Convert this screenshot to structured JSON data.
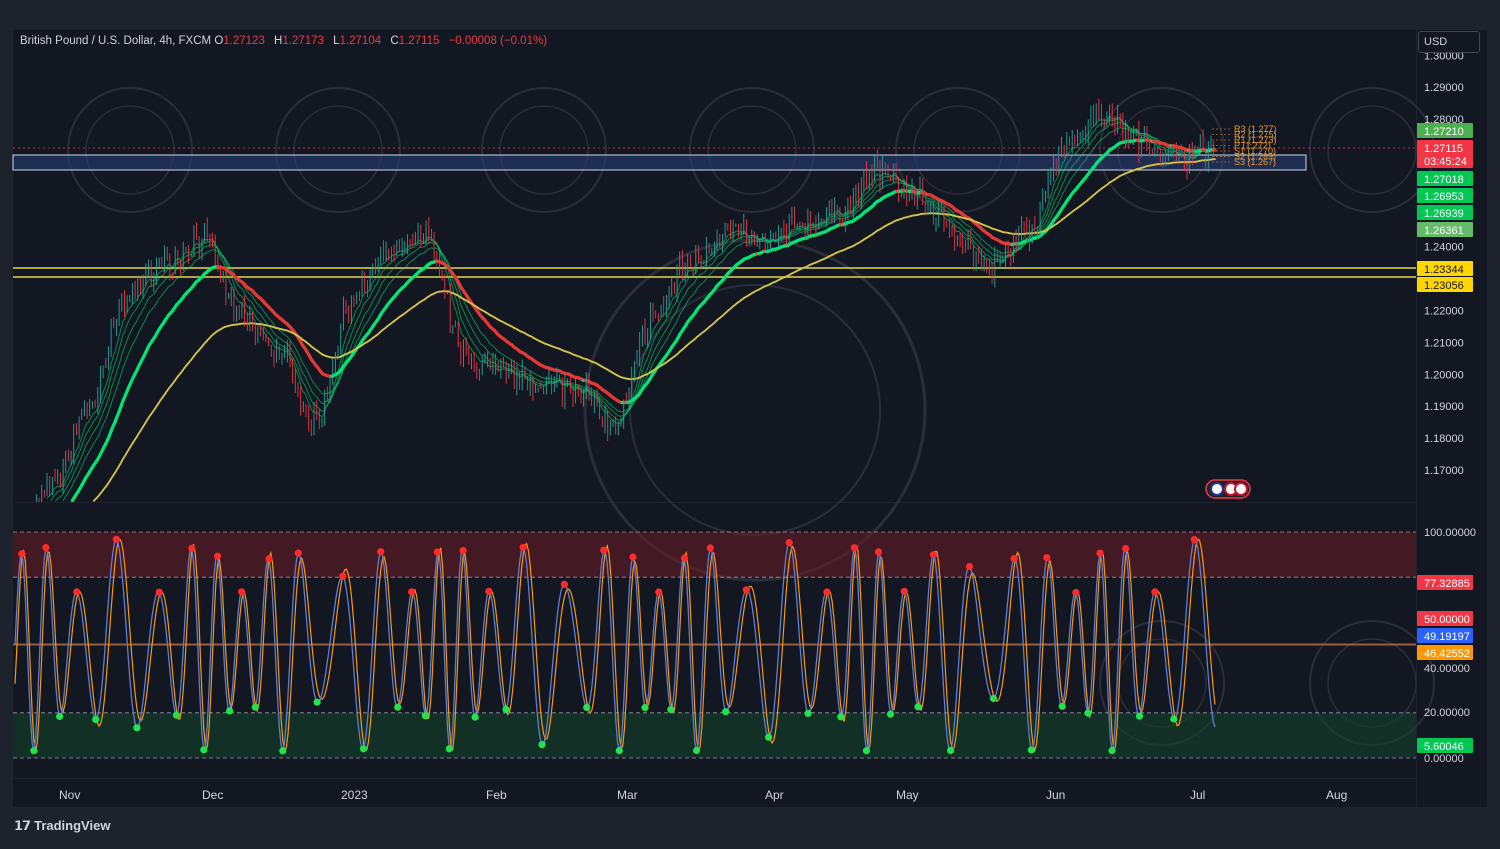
{
  "header": {
    "symbol": "British Pound / U.S. Dollar, 4h, FXCM",
    "o_label": "O",
    "o_value": "1.27123",
    "h_label": "H",
    "h_value": "1.27173",
    "l_label": "L",
    "l_value": "1.27104",
    "c_label": "C",
    "c_value": "1.27115",
    "change": "−0.00008 (−0.01%)"
  },
  "currency": "USD",
  "brand": "TradingView",
  "colors": {
    "background": "#1e222d",
    "pane_bg": "#131722",
    "bull": "#26a69a",
    "bear": "#f23645",
    "ema_fast": "#00e676",
    "ema_slow": "#d4c34a",
    "ribbon_bear": "#e53935",
    "zone_blue": "#2a3f7a",
    "yellow_line": "#e8d44a",
    "osc_blue": "#5b7fd6",
    "osc_orange": "#ff9800",
    "dot_red": "#ff2a2a",
    "dot_green": "#22e34d"
  },
  "chart_data": [
    {
      "type": "line",
      "name": "price",
      "x_labels": [
        "Nov",
        "Dec",
        "2023",
        "Feb",
        "Mar",
        "Apr",
        "May",
        "Jun",
        "Jul",
        "Aug"
      ],
      "y_ticks": [
        "1.30000",
        "1.29000",
        "1.28000",
        "1.24000",
        "1.22000",
        "1.21000",
        "1.20000",
        "1.19000",
        "1.18000",
        "1.17000"
      ],
      "ylim": [
        1.165,
        1.3
      ],
      "x": [
        "Nov 1",
        "Nov 10",
        "Nov 20",
        "Dec 1",
        "Dec 10",
        "Dec 15",
        "Dec 22",
        "Jan 1",
        "Jan 6",
        "Jan 14",
        "Jan 24",
        "Feb 1",
        "Feb 8",
        "Feb 17",
        "Feb 24",
        "Mar 1",
        "Mar 8",
        "Mar 15",
        "Mar 24",
        "Apr 1",
        "Apr 10",
        "Apr 18",
        "Apr 28",
        "May 5",
        "May 12",
        "May 20",
        "May 27",
        "Jun 5",
        "Jun 12",
        "Jun 18",
        "Jun 25",
        "Jul 1",
        "Jul 5"
      ],
      "values": [
        1.148,
        1.165,
        1.19,
        1.225,
        1.235,
        1.243,
        1.218,
        1.207,
        1.185,
        1.224,
        1.238,
        1.243,
        1.205,
        1.2,
        1.197,
        1.196,
        1.183,
        1.218,
        1.235,
        1.245,
        1.241,
        1.247,
        1.251,
        1.264,
        1.256,
        1.245,
        1.233,
        1.245,
        1.272,
        1.282,
        1.273,
        1.268,
        1.271
      ],
      "price_labels": [
        {
          "value": "1.27210",
          "color": "#4caf50"
        },
        {
          "value": "1.27115",
          "color": "#f23645",
          "countdown": "03:45:24"
        },
        {
          "value": "1.27018",
          "color": "#00c853"
        },
        {
          "value": "1.26953",
          "color": "#00c853"
        },
        {
          "value": "1.26939",
          "color": "#00c853"
        },
        {
          "value": "1.26361",
          "color": "#66bb6a"
        },
        {
          "value": "1.23344",
          "color": "#ffd600"
        },
        {
          "value": "1.23056",
          "color": "#ffd600"
        }
      ],
      "pivot_labels": [
        "R3 (1.277)",
        "R2 (1.275)",
        "R1 (1.273)",
        "P (1.272)",
        "S1 (1.270)",
        "S2 (1.269)",
        "S3 (1.267)"
      ]
    },
    {
      "type": "line",
      "name": "oscillator",
      "y_ticks": [
        "100.00000",
        "77.32885",
        "50.00000",
        "49.19197",
        "46.42552",
        "40.00000",
        "20.00000",
        "5.60046",
        "0.00000"
      ],
      "ylim": [
        0,
        100
      ],
      "levels": [
        100,
        80,
        50,
        20,
        0
      ],
      "value_labels": [
        {
          "value": "77.32885",
          "color": "#f23645"
        },
        {
          "value": "50.00000",
          "color": "#f23645"
        },
        {
          "value": "49.19197",
          "color": "#2962ff"
        },
        {
          "value": "46.42552",
          "color": "#ff9800"
        },
        {
          "value": "5.60046",
          "color": "#00c853"
        }
      ]
    }
  ]
}
